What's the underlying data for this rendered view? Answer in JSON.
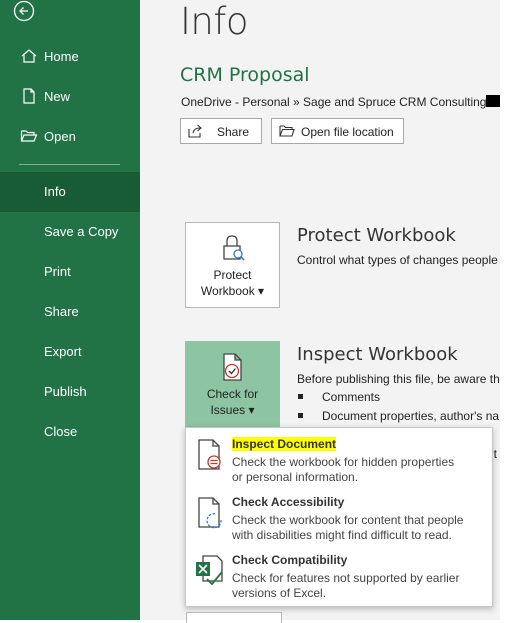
{
  "sidebar": {
    "items": [
      {
        "label": "Home",
        "icon": "home-icon"
      },
      {
        "label": "New",
        "icon": "new-document-icon"
      },
      {
        "label": "Open",
        "icon": "open-folder-icon"
      },
      {
        "label": "Info",
        "active": true
      },
      {
        "label": "Save a Copy"
      },
      {
        "label": "Print"
      },
      {
        "label": "Share"
      },
      {
        "label": "Export"
      },
      {
        "label": "Publish"
      },
      {
        "label": "Close"
      }
    ]
  },
  "main": {
    "title": "Info",
    "file_name": "CRM Proposal",
    "breadcrumb": "OneDrive - Personal » Sage and Spruce CRM Consulting »",
    "share_label": "Share",
    "open_location_label": "Open file location"
  },
  "protect": {
    "button_line1": "Protect",
    "button_line2": "Workbook ▾",
    "title": "Protect Workbook",
    "desc": "Control what types of changes people"
  },
  "inspect": {
    "button_line1": "Check for",
    "button_line2": "Issues ▾",
    "title": "Inspect Workbook",
    "desc": "Before publishing this file, be aware th",
    "bullets": [
      "Comments",
      "Document properties, author's na"
    ],
    "trailing_fragment": "it"
  },
  "menu": {
    "items": [
      {
        "title": "Inspect Document",
        "desc1": "Check the workbook for hidden properties",
        "desc2": "or personal information.",
        "highlighted": true
      },
      {
        "title": "Check Accessibility",
        "desc1": "Check the workbook for content that people",
        "desc2": "with disabilities might find difficult to read."
      },
      {
        "title": "Check Compatibility",
        "desc1": "Check for features not supported by earlier",
        "desc2": "versions of Excel."
      }
    ]
  },
  "colors": {
    "sidebar": "#217346",
    "sidebar_active": "#185c35",
    "accent_text": "#217346",
    "selected_button": "#8dc5a2",
    "highlight": "#ffff00"
  }
}
